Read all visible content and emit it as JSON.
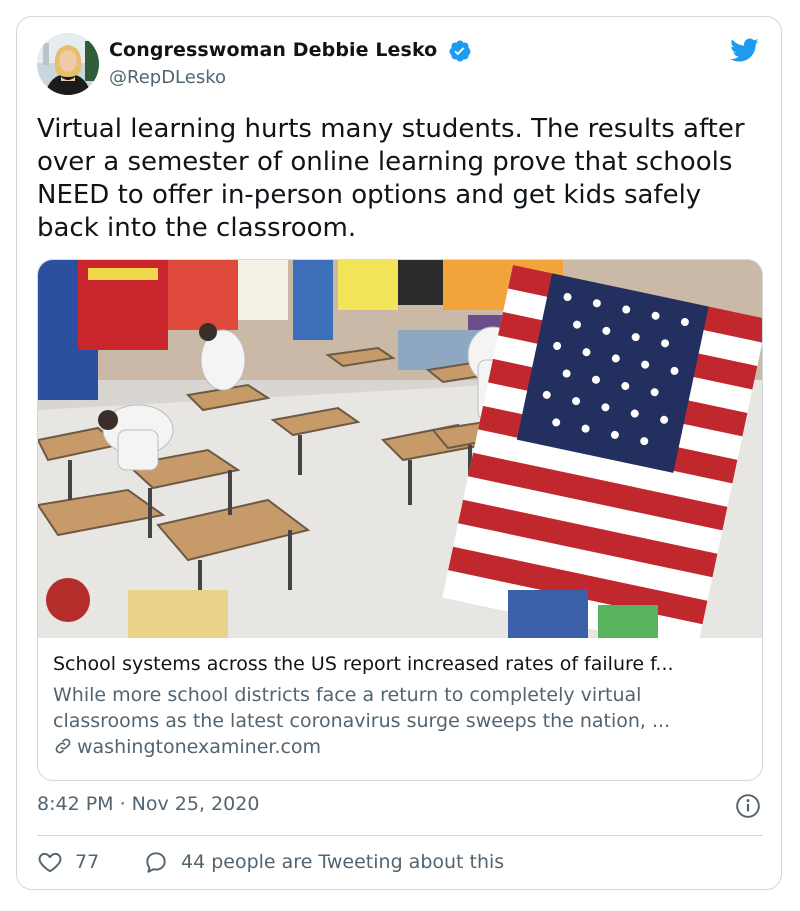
{
  "author": {
    "name": "Congresswoman Debbie Lesko",
    "handle": "@RepDLesko",
    "verified": true,
    "avatar": "avatar-photo"
  },
  "tweet": {
    "text": "Virtual learning hurts many students. The results after\nover a semester of online learning prove that schools\nNEED to offer in-person options and get kids safely\nback into the classroom."
  },
  "link_card": {
    "image": "classroom-photo-with-american-flag",
    "title": "School systems across the US report increased rates of failure f...",
    "description": "While more school districts face a return to completely virtual\nclassrooms as the latest coronavirus surge sweeps the nation, ...",
    "domain": "washingtonexaminer.com",
    "domain_icon": "link-icon"
  },
  "meta": {
    "timestamp": "8:42 PM · Nov 25, 2020",
    "info_icon": "info-icon"
  },
  "actions": {
    "likes": "77",
    "like_icon": "heart-icon",
    "reply_text": "44 people are Tweeting about this",
    "reply_icon": "speech-bubble-icon"
  },
  "colors": {
    "brand": "#1d9bf0",
    "text": "#0f1419",
    "secondary": "#536471",
    "border": "#cfd9de"
  },
  "platform_icon": "twitter-bird-icon"
}
